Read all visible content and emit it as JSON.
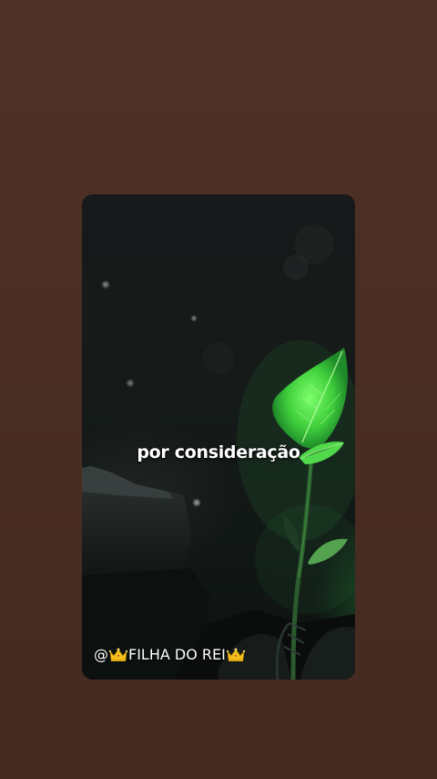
{
  "video": {
    "caption": "por consideração",
    "watermark": {
      "prefix": "@",
      "text": "FILHA DO REI",
      "icon": "crown-icon"
    }
  },
  "colors": {
    "background": "#4a2e24",
    "card": "#151a18",
    "leaf": "#4cd44a",
    "caption": "#ffffff"
  }
}
